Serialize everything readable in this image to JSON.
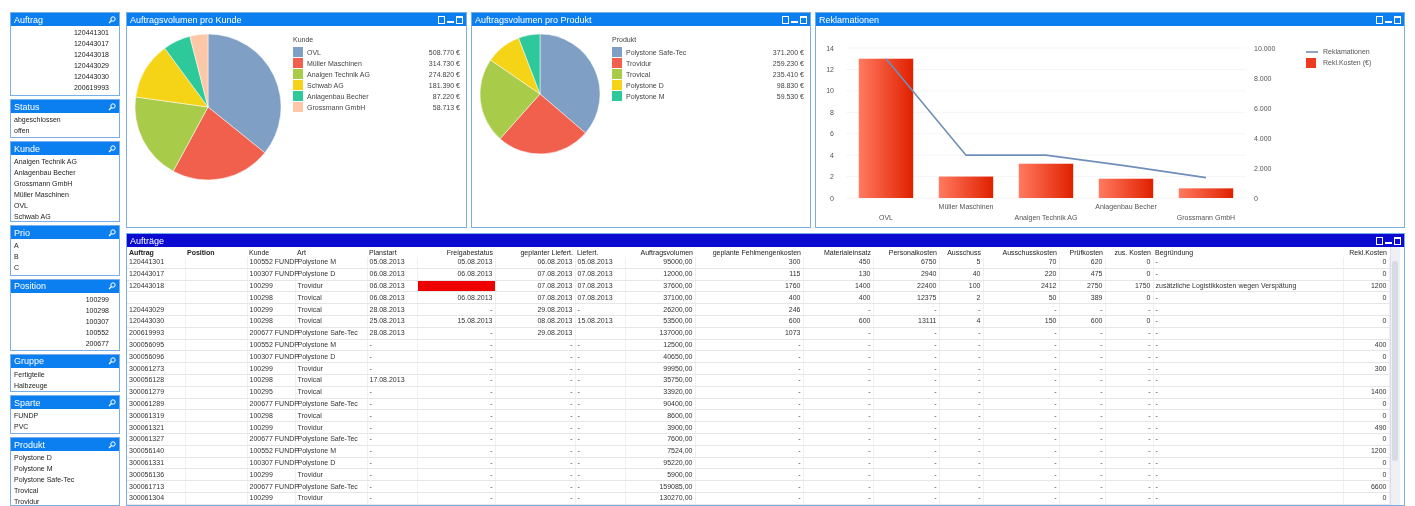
{
  "listboxes": [
    {
      "title": "Auftrag",
      "items": [
        "120441301",
        "120443017",
        "120443018",
        "120443029",
        "120443030",
        "200619993"
      ]
    },
    {
      "title": "Status",
      "items": [
        "abgeschlossen",
        "offen"
      ]
    },
    {
      "title": "Kunde",
      "items": [
        "Analgen Technik AG",
        "Anlagenbau Becher",
        "Grossmann GmbH",
        "Müller Maschinen",
        "OVL",
        "Schwab AG"
      ]
    },
    {
      "title": "Prio",
      "items": [
        "A",
        "B",
        "C"
      ]
    },
    {
      "title": "Position",
      "items": [
        "100299",
        "100298",
        "100307",
        "100552",
        "200677"
      ]
    },
    {
      "title": "Gruppe",
      "items": [
        "Fertigteile",
        "Halbzeuge"
      ]
    },
    {
      "title": "Sparte",
      "items": [
        "FUNDP",
        "PVC"
      ]
    },
    {
      "title": "Produkt",
      "items": [
        "Polystone D",
        "Polystone M",
        "Polystone Safe-Tec",
        "Trovical",
        "Trovidur"
      ]
    }
  ],
  "pie_customer": {
    "title": "Auftragsvolumen pro Kunde",
    "legend_values": [
      "508.770 €",
      "314.730 €",
      "274.820 €",
      "181.390 €",
      "87.220 €",
      "58.713 €"
    ],
    "chart_data": {
      "type": "pie",
      "legend_title": "Kunde",
      "categories": [
        "OVL",
        "Müller Maschinen",
        "Analgen Technik AG",
        "Schwab AG",
        "Anlagenbau Becher",
        "Grossmann GmbH"
      ],
      "values": [
        35.8,
        22.1,
        19.3,
        12.7,
        6.1,
        4.0
      ],
      "colors": [
        "#7f9fc4",
        "#f0604d",
        "#a8cc4a",
        "#f5d316",
        "#2ec99a",
        "#fcc8a8"
      ]
    }
  },
  "pie_product": {
    "title": "Auftragsvolumen pro Produkt",
    "legend_values": [
      "371.200 €",
      "259.230 €",
      "235.410 €",
      "98.830 €",
      "59.530 €"
    ],
    "chart_data": {
      "type": "pie",
      "legend_title": "Produkt",
      "categories": [
        "Polystone Safe-Tec",
        "Trovidur",
        "Trovical",
        "Polystone D",
        "Polystone M"
      ],
      "values": [
        36.3,
        25.3,
        23.0,
        9.6,
        5.8
      ],
      "colors": [
        "#7f9fc4",
        "#f0604d",
        "#a8cc4a",
        "#f5d316",
        "#2ec99a"
      ]
    }
  },
  "complaints": {
    "title": "Reklamationen",
    "chart_data": {
      "type": "bar",
      "categories": [
        "OVL",
        "Müller Maschinen",
        "Analgen Technik AG",
        "Anlagenbau Becher",
        "Grossmann GmbH"
      ],
      "series": [
        {
          "name": "Reklamationen",
          "type": "line",
          "color": "#6f8fb8",
          "values": [
            13,
            4,
            4,
            3,
            1.9
          ]
        },
        {
          "name": "Rekl.Kosten (€)",
          "type": "bar",
          "color": "#f03a20",
          "values": [
            13,
            2,
            3.2,
            1.8,
            0.9
          ]
        }
      ],
      "grid": true,
      "legend": "right",
      "ylim": [
        0,
        14
      ],
      "yticks": [
        0,
        2,
        4,
        6,
        8,
        10,
        12,
        14
      ],
      "y2lim": [
        0,
        10000
      ],
      "y2ticks": [
        {
          "value": 0,
          "label": "0"
        },
        {
          "value": 2000,
          "label": "2.000"
        },
        {
          "value": 4000,
          "label": "4.000"
        },
        {
          "value": 6000,
          "label": "6.000"
        },
        {
          "value": 8000,
          "label": "8.000"
        },
        {
          "value": 10000,
          "label": "10.000"
        }
      ]
    }
  },
  "orders": {
    "title": "Aufträge",
    "columns": [
      "Auftrag",
      "Position",
      "Kunde",
      "Art",
      "Planstart",
      "Freigabestatus",
      "geplanter Liefert.",
      "Liefert.",
      "Auftragsvolumen",
      "geplante Fehlmengenkosten",
      "Materialeinsatz",
      "Personalkosten",
      "Ausschuss",
      "Ausschusskosten",
      "Prüfkosten",
      "zus. Kosten",
      "Begründung",
      "Rekl.Kosten"
    ],
    "rows": [
      {
        "alert": false,
        "cells": [
          "120441301",
          null,
          "100552 FUNDP",
          "Polystone M",
          "05.08.2013",
          "05.08.2013",
          "06.08.2013",
          "05.08.2013",
          "95000,00",
          "300",
          "450",
          "6750",
          "5",
          "70",
          "620",
          "0",
          "-",
          "0"
        ]
      },
      {
        "alert": false,
        "cells": [
          "120443017",
          null,
          "100307 FUNDP",
          "Polystone D",
          "06.08.2013",
          "06.08.2013",
          "07.08.2013",
          "07.08.2013",
          "12000,00",
          "115",
          "130",
          "2940",
          "40",
          "220",
          "475",
          "0",
          "-",
          "0"
        ]
      },
      {
        "alert": true,
        "cells": [
          "120443018",
          null,
          "100299",
          "Trovidur",
          "06.08.2013",
          null,
          "07.08.2013",
          "07.08.2013",
          "37600,00",
          "1760",
          "1400",
          "22400",
          "100",
          "2412",
          "2750",
          "1750",
          "zusätzliche Logistikkosten wegen Verspätung",
          "1200"
        ]
      },
      {
        "alert": false,
        "cells": [
          null,
          null,
          "100298",
          "Trovical",
          "06.08.2013",
          "06.08.2013",
          "07.08.2013",
          "07.08.2013",
          "37100,00",
          "400",
          "400",
          "12375",
          "2",
          "50",
          "389",
          "0",
          "-",
          "0"
        ]
      },
      {
        "alert": false,
        "cells": [
          "120443029",
          null,
          "100299",
          "Trovical",
          "28.08.2013",
          "-",
          "29.08.2013",
          "-",
          "26200,00",
          "246",
          "-",
          "-",
          "-",
          "-",
          "-",
          "-",
          "-",
          null
        ]
      },
      {
        "alert": false,
        "cells": [
          "120443030",
          null,
          "100298",
          "Trovical",
          "25.08.2013",
          "15.08.2013",
          "08.08.2013",
          "15.08.2013",
          "53500,00",
          "600",
          "600",
          "13111",
          "4",
          "150",
          "600",
          "0",
          "-",
          "0"
        ]
      },
      {
        "alert": false,
        "cells": [
          "200619993",
          null,
          "200677 FUNDP",
          "Polystone Safe-Tec",
          "28.08.2013",
          "-",
          "29.08.2013",
          null,
          "137000,00",
          "1073",
          "-",
          "-",
          "-",
          "-",
          "-",
          "-",
          "-",
          null
        ]
      },
      {
        "alert": false,
        "cells": [
          "300056095",
          null,
          "100552 FUNDP",
          "Polystone M",
          "-",
          "-",
          "-",
          "-",
          "12500,00",
          "-",
          "-",
          "-",
          "-",
          "-",
          "-",
          "-",
          "-",
          "400"
        ]
      },
      {
        "alert": false,
        "cells": [
          "300056096",
          null,
          "100307 FUNDP",
          "Polystone D",
          "-",
          "-",
          "-",
          "-",
          "40650,00",
          "-",
          "-",
          "-",
          "-",
          "-",
          "-",
          "-",
          "-",
          "0"
        ]
      },
      {
        "alert": false,
        "cells": [
          "300061273",
          null,
          "100299",
          "Trovidur",
          "-",
          "-",
          "-",
          "-",
          "99950,00",
          "-",
          "-",
          "-",
          "-",
          "-",
          "-",
          "-",
          "-",
          "300"
        ]
      },
      {
        "alert": false,
        "cells": [
          "300056128",
          null,
          "100298",
          "Trovical",
          "17.08.2013",
          "-",
          "-",
          "-",
          "35750,00",
          "-",
          "-",
          "-",
          "-",
          "-",
          "-",
          "-",
          "-",
          null
        ]
      },
      {
        "alert": false,
        "cells": [
          "300061279",
          null,
          "100295",
          "Trovical",
          "-",
          "-",
          "-",
          "-",
          "33920,00",
          "-",
          "-",
          "-",
          "-",
          "-",
          "-",
          "-",
          "-",
          "1400"
        ]
      },
      {
        "alert": false,
        "cells": [
          "300061289",
          null,
          "200677 FUNDP",
          "Polystone Safe-Tec",
          "-",
          "-",
          "-",
          "-",
          "90400,00",
          "-",
          "-",
          "-",
          "-",
          "-",
          "-",
          "-",
          "-",
          "0"
        ]
      },
      {
        "alert": false,
        "cells": [
          "300061319",
          null,
          "100298",
          "Trovical",
          "-",
          "-",
          "-",
          "-",
          "8600,00",
          "-",
          "-",
          "-",
          "-",
          "-",
          "-",
          "-",
          "-",
          "0"
        ]
      },
      {
        "alert": false,
        "cells": [
          "300061321",
          null,
          "100299",
          "Trovidur",
          "-",
          "-",
          "-",
          "-",
          "3900,00",
          "-",
          "-",
          "-",
          "-",
          "-",
          "-",
          "-",
          "-",
          "490"
        ]
      },
      {
        "alert": false,
        "cells": [
          "300061327",
          null,
          "200677 FUNDP",
          "Polystone Safe-Tec",
          "-",
          "-",
          "-",
          "-",
          "7600,00",
          "-",
          "-",
          "-",
          "-",
          "-",
          "-",
          "-",
          "-",
          "0"
        ]
      },
      {
        "alert": false,
        "cells": [
          "300056140",
          null,
          "100552 FUNDP",
          "Polystone M",
          "-",
          "-",
          "-",
          "-",
          "7524,00",
          "-",
          "-",
          "-",
          "-",
          "-",
          "-",
          "-",
          "-",
          "1200"
        ]
      },
      {
        "alert": false,
        "cells": [
          "300061331",
          null,
          "100307 FUNDP",
          "Polystone D",
          "-",
          "-",
          "-",
          "-",
          "95220,00",
          "-",
          "-",
          "-",
          "-",
          "-",
          "-",
          "-",
          "-",
          "0"
        ]
      },
      {
        "alert": false,
        "cells": [
          "300056136",
          null,
          "100299",
          "Trovidur",
          "-",
          "-",
          "-",
          "-",
          "5900,00",
          "-",
          "-",
          "-",
          "-",
          "-",
          "-",
          "-",
          "-",
          "0"
        ]
      },
      {
        "alert": false,
        "cells": [
          "300061713",
          null,
          "200677 FUNDP",
          "Polystone Safe-Tec",
          "-",
          "-",
          "-",
          "-",
          "159085,00",
          "-",
          "-",
          "-",
          "-",
          "-",
          "-",
          "-",
          "-",
          "6600"
        ]
      },
      {
        "alert": false,
        "cells": [
          "300061304",
          null,
          "100299",
          "Trovidur",
          "-",
          "-",
          "-",
          "-",
          "130270,00",
          "-",
          "-",
          "-",
          "-",
          "-",
          "-",
          "-",
          "-",
          "0"
        ]
      }
    ]
  }
}
